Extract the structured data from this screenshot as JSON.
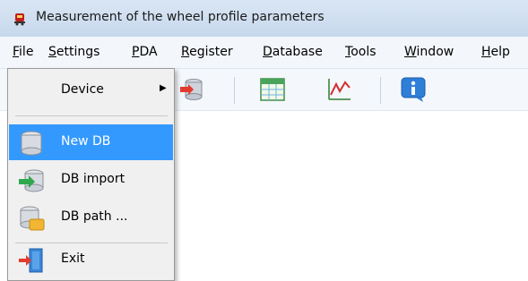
{
  "window": {
    "title": "Measurement of the wheel profile parameters"
  },
  "menubar": {
    "items": [
      {
        "pre": "",
        "u": "F",
        "post": "ile"
      },
      {
        "pre": "",
        "u": "S",
        "post": "ettings"
      },
      {
        "pre": "",
        "u": "P",
        "post": "DA"
      },
      {
        "pre": "",
        "u": "R",
        "post": "egister"
      },
      {
        "pre": "",
        "u": "D",
        "post": "atabase"
      },
      {
        "pre": "",
        "u": "T",
        "post": "ools"
      },
      {
        "pre": "",
        "u": "W",
        "post": "indow"
      },
      {
        "pre": "",
        "u": "H",
        "post": "elp"
      }
    ]
  },
  "file_menu": {
    "device": "Device",
    "new_db": "New DB",
    "db_import": "DB import",
    "db_path": "DB path ...",
    "exit": "Exit"
  },
  "icons": {
    "app": "train-app-icon",
    "toolbar": [
      "database-icon",
      "table-icon",
      "chart-icon",
      "info-icon"
    ]
  },
  "colors": {
    "selection": "#3399ff",
    "title_bg": "#d4e2f3"
  }
}
